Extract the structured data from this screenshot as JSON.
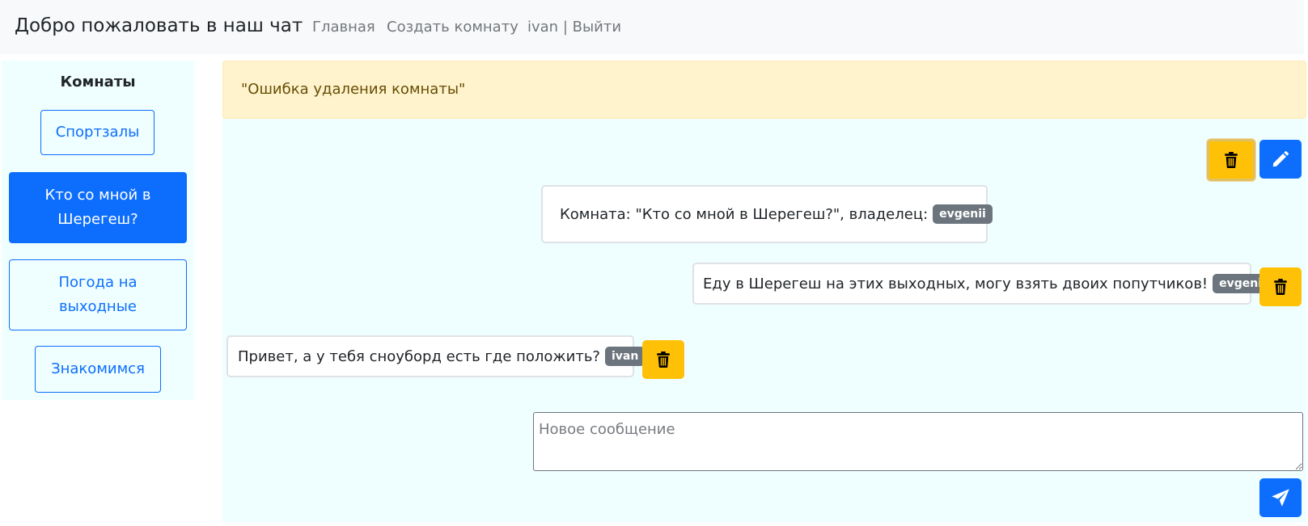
{
  "navbar": {
    "brand": "Добро пожаловать в наш чат",
    "links": [
      "Главная",
      "Создать комнату",
      "ivan | Выйти"
    ]
  },
  "sidebar": {
    "title": "Комнаты",
    "rooms": [
      {
        "label": "Спортзалы",
        "active": false
      },
      {
        "label": "Кто со мной в Шерегеш?",
        "active": true
      },
      {
        "label": "Погода на выходные",
        "active": false
      },
      {
        "label": "Знакомимся",
        "active": false
      }
    ]
  },
  "alert": {
    "text": "\"Ошибка удаления комнаты\""
  },
  "room_info": {
    "text": "Комната: \"Кто со мной в Шерегеш?\", владелец:",
    "owner": "evgenii"
  },
  "messages": [
    {
      "text": "Еду в Шерегеш на этих выходных, могу взять двоих попутчиков!",
      "author": "evgenii"
    },
    {
      "text": "Привет, а у тебя сноуборд есть где положить?",
      "author": "ivan"
    }
  ],
  "composer": {
    "placeholder": "Новое сообщение",
    "value": ""
  },
  "icons": {
    "delete": "trash-icon",
    "edit": "pencil-icon",
    "send": "send-icon"
  },
  "colors": {
    "primary": "#0d6efd",
    "warning": "#ffc107",
    "alert_bg": "#fff3cd",
    "panel_bg": "#effeff",
    "badge": "#6c757d"
  }
}
